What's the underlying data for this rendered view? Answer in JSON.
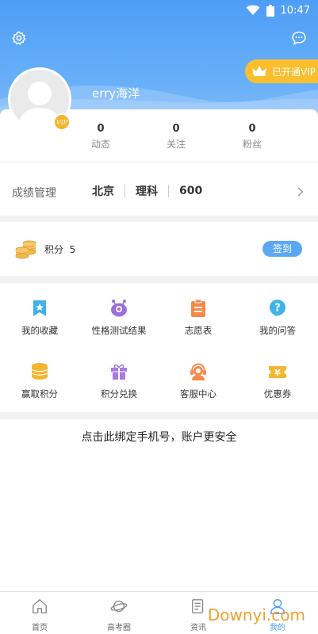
{
  "status_bar": {
    "time": "10:47"
  },
  "profile": {
    "username": "erry海洋",
    "vip_label": "已开通VIP",
    "vip_badge": "VIP"
  },
  "stats": [
    {
      "value": "0",
      "label": "动态"
    },
    {
      "value": "0",
      "label": "关注"
    },
    {
      "value": "0",
      "label": "粉丝"
    }
  ],
  "score": {
    "title": "成绩管理",
    "province": "北京",
    "subject": "理科",
    "points": "600"
  },
  "points": {
    "label": "积分",
    "value": "5",
    "checkin_label": "签到"
  },
  "grid": [
    {
      "label": "我的收藏",
      "icon": "favorites-icon"
    },
    {
      "label": "性格测试结果",
      "icon": "personality-test-icon"
    },
    {
      "label": "志愿表",
      "icon": "application-form-icon"
    },
    {
      "label": "我的问答",
      "icon": "qa-icon"
    },
    {
      "label": "赢取积分",
      "icon": "coins-stack-icon"
    },
    {
      "label": "积分兑换",
      "icon": "gift-icon"
    },
    {
      "label": "客服中心",
      "icon": "customer-service-icon"
    },
    {
      "label": "优惠券",
      "icon": "coupon-icon"
    }
  ],
  "bind_phone_text": "点击此绑定手机号，账户更安全",
  "tabs": [
    {
      "label": "首页",
      "icon": "home-icon"
    },
    {
      "label": "高考圈",
      "icon": "planet-icon"
    },
    {
      "label": "资讯",
      "icon": "news-icon"
    },
    {
      "label": "我的",
      "icon": "user-icon"
    }
  ],
  "watermark": "Downyi.com",
  "colors": {
    "primary": "#4e9ef7",
    "vip_gold": "#fbbf2e",
    "watermark": "#f0a12f"
  }
}
